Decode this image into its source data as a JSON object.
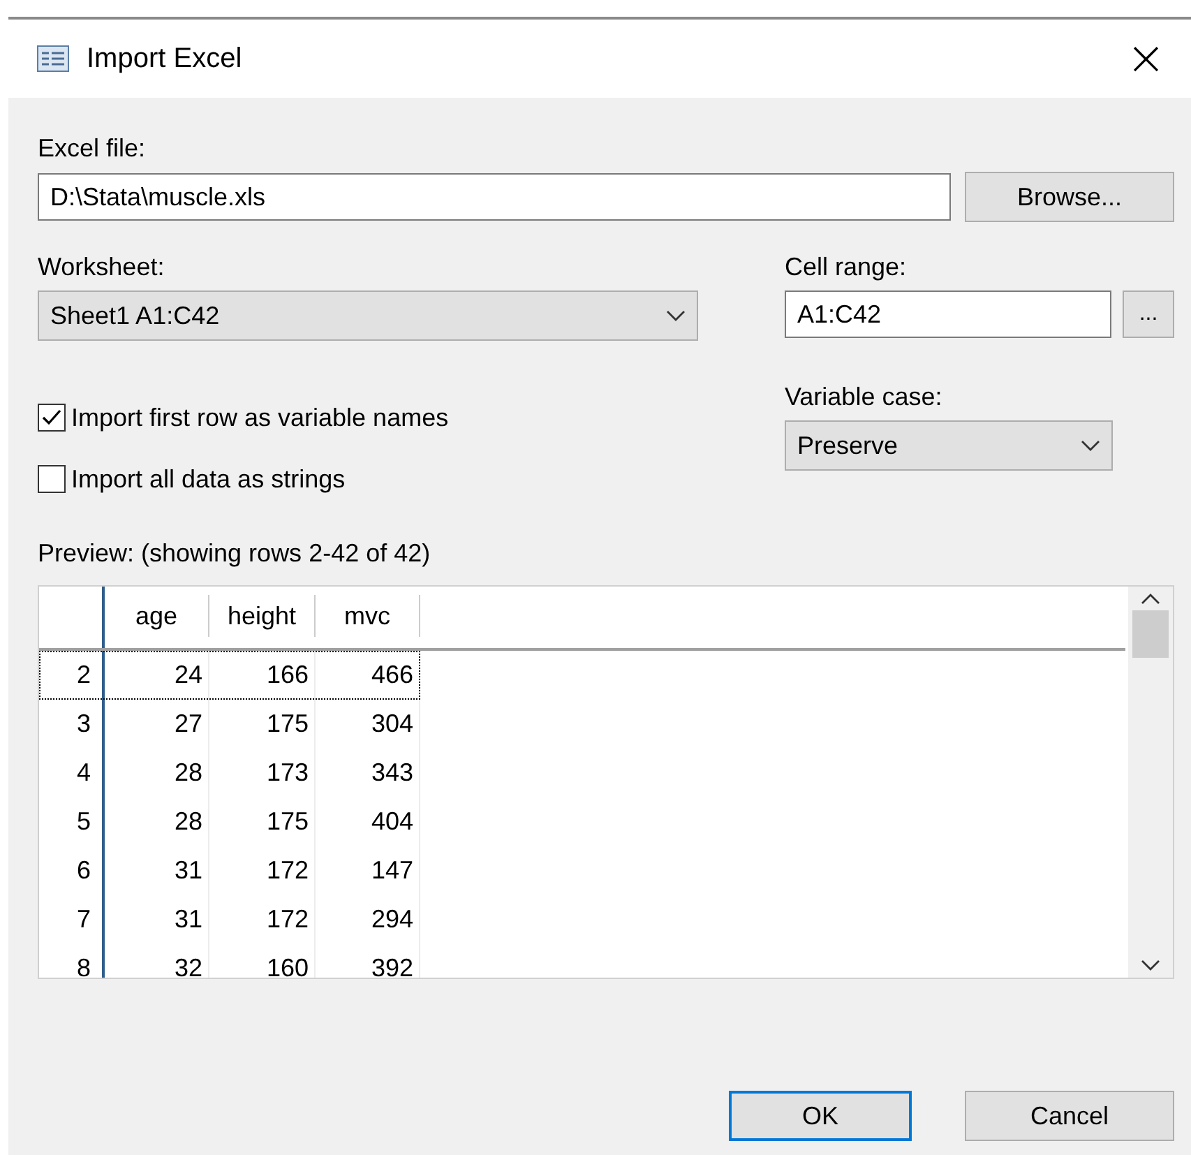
{
  "window": {
    "title": "Import Excel",
    "close": "×"
  },
  "excel_file": {
    "label": "Excel file:",
    "value": "D:\\Stata\\muscle.xls",
    "browse": "Browse..."
  },
  "worksheet": {
    "label": "Worksheet:",
    "value": "Sheet1 A1:C42"
  },
  "cell_range": {
    "label": "Cell range:",
    "value": "A1:C42",
    "picker": "..."
  },
  "options": [
    {
      "label": "Import first row as variable names",
      "checked": true
    },
    {
      "label": "Import all data as strings",
      "checked": false
    }
  ],
  "variable_case": {
    "label": "Variable case:",
    "value": "Preserve"
  },
  "preview": {
    "label": "Preview: (showing rows 2-42 of 42)",
    "columns": [
      "age",
      "height",
      "mvc"
    ],
    "rows": [
      {
        "number": "2",
        "cells": [
          "24",
          "166",
          "466"
        ],
        "selected": true
      },
      {
        "number": "3",
        "cells": [
          "27",
          "175",
          "304"
        ],
        "selected": false
      },
      {
        "number": "4",
        "cells": [
          "28",
          "173",
          "343"
        ],
        "selected": false
      },
      {
        "number": "5",
        "cells": [
          "28",
          "175",
          "404"
        ],
        "selected": false
      },
      {
        "number": "6",
        "cells": [
          "31",
          "172",
          "147"
        ],
        "selected": false
      },
      {
        "number": "7",
        "cells": [
          "31",
          "172",
          "294"
        ],
        "selected": false
      },
      {
        "number": "8",
        "cells": [
          "32",
          "160",
          "392"
        ],
        "selected": false
      }
    ]
  },
  "buttons": [
    {
      "label": "OK",
      "default": true
    },
    {
      "label": "Cancel",
      "default": false
    }
  ]
}
